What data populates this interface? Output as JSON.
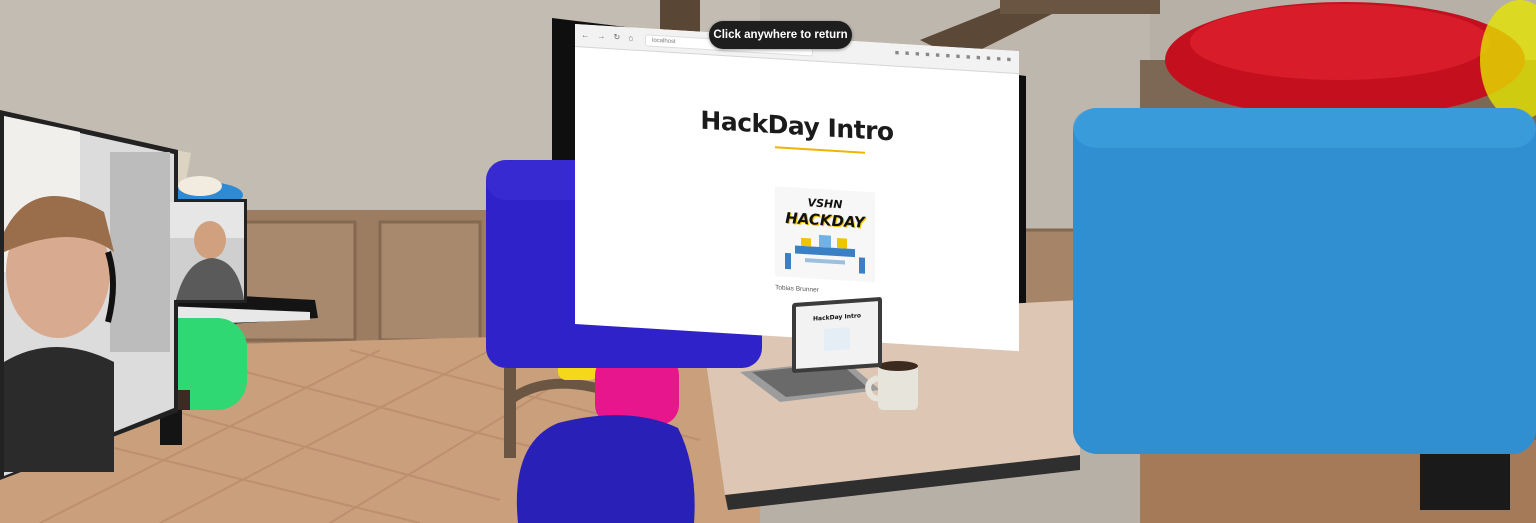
{
  "overlay": {
    "return_label": "Click anywhere to return"
  },
  "presentation": {
    "browser_address": "localhost",
    "slide_title": "HackDay Intro",
    "logo_line1": "VSHN",
    "logo_line2": "HACKDAY",
    "author": "Tobias Brunner"
  },
  "laptop": {
    "slide_title": "HackDay Intro"
  },
  "colors": {
    "pill_bg": "#1e1e1e",
    "slide_accent": "#f0b400",
    "avatar_blue": "#2f22c8",
    "avatar_light_blue": "#2f8fd0",
    "avatar_red": "#c4101e",
    "avatar_green": "#2fd872",
    "avatar_magenta": "#e8168c"
  }
}
